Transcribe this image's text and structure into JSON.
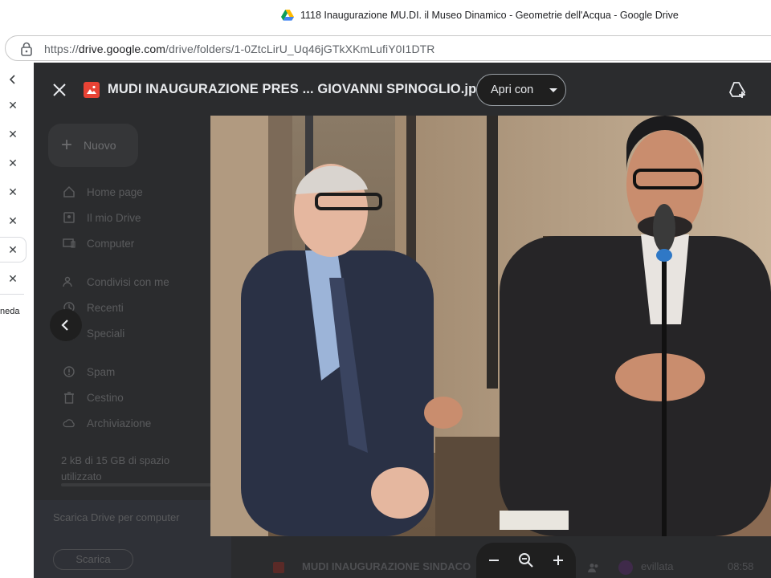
{
  "window": {
    "title": "1118 Inaugurazione MU.DI. il Museo Dinamico - Geometrie dell'Acqua - Google Drive"
  },
  "address_bar": {
    "url_prefix": "https://",
    "url_domain": "drive.google.com",
    "url_path": "/drive/folders/1-0ZtcLirU_Uq46jGTkXKmLufiY0I1DTR"
  },
  "vertical_tabs": {
    "back_icon": "chevron-left-icon",
    "close_glyph": "✕",
    "partial_label": "neda"
  },
  "drive_sidebar": {
    "new_label": "Nuovo",
    "nav_items": [
      {
        "label": "Home page",
        "icon": "home-icon"
      },
      {
        "label": "Il mio Drive",
        "icon": "my-drive-icon"
      },
      {
        "label": "Computer",
        "icon": "computer-icon"
      },
      {
        "label": "Condivisi con me",
        "icon": "shared-icon"
      },
      {
        "label": "Recenti",
        "icon": "clock-icon"
      },
      {
        "label": "Speciali",
        "icon": "star-icon"
      },
      {
        "label": "Spam",
        "icon": "spam-icon"
      },
      {
        "label": "Cestino",
        "icon": "trash-icon"
      },
      {
        "label": "Archiviazione",
        "icon": "cloud-icon"
      }
    ],
    "storage_text": "2 kB di 15 GB di spazio utilizzato",
    "promo_text": "Scarica Drive per computer",
    "promo_button": "Scarica"
  },
  "file_list": {
    "row_name": "MUDI INAUGURAZIONE SINDACO",
    "row_owner": "evillata",
    "row_time": "08:58"
  },
  "viewer": {
    "file_title": "MUDI INAUGURAZIONE PRES ... GIOVANNI SPINOGLIO.jpg",
    "open_with_label": "Apri con",
    "colors": {
      "overlay": "#2b2c2e",
      "header_text": "#e8eaed",
      "image_badge": "#e84335"
    }
  }
}
